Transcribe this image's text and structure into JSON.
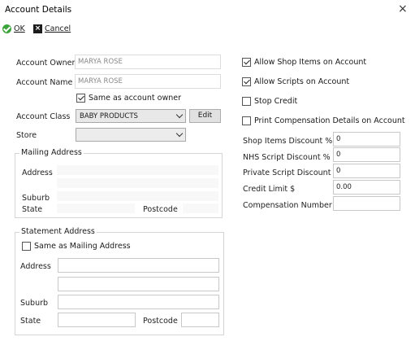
{
  "window": {
    "title": "Account Details",
    "close_glyph": "×"
  },
  "toolbar": {
    "ok_label": "OK",
    "cancel_label": "Cancel"
  },
  "account": {
    "owner_label": "Account Owner",
    "owner_value": "MARYA ROSE",
    "name_label": "Account Name",
    "name_value": "MARYA ROSE",
    "same_as_owner_label": "Same as account owner",
    "same_as_owner_checked": true,
    "class_label": "Account Class",
    "class_value": "BABY PRODUCTS",
    "edit_label": "Edit",
    "store_label": "Store",
    "store_value": ""
  },
  "mailing": {
    "legend": "Mailing Address",
    "address_label": "Address",
    "suburb_label": "Suburb",
    "state_label": "State",
    "postcode_label": "Postcode"
  },
  "statement": {
    "legend": "Statement Address",
    "same_as_mailing_label": "Same as Mailing Address",
    "same_as_mailing_checked": false,
    "address_label": "Address",
    "suburb_label": "Suburb",
    "state_label": "State",
    "postcode_label": "Postcode"
  },
  "options": {
    "allow_shop_items": {
      "label": "Allow Shop Items on Account",
      "checked": true
    },
    "allow_scripts": {
      "label": "Allow Scripts on Account",
      "checked": true
    },
    "stop_credit": {
      "label": "Stop Credit",
      "checked": false
    },
    "print_compensation": {
      "label": "Print Compensation Details on Account",
      "checked": false
    }
  },
  "discounts": {
    "shop_items_label": "Shop Items Discount %",
    "shop_items_value": "0",
    "nhs_script_label": "NHS Script Discount %",
    "nhs_script_value": "0",
    "private_script_label": "Private Script Discount %",
    "private_script_value": "0",
    "credit_limit_label": "Credit Limit $",
    "credit_limit_value": "0.00",
    "compensation_label": "Compensation Number",
    "compensation_value": ""
  },
  "colors": {
    "ok_green": "#3aa43a",
    "cancel_black": "#1b1b1b"
  }
}
